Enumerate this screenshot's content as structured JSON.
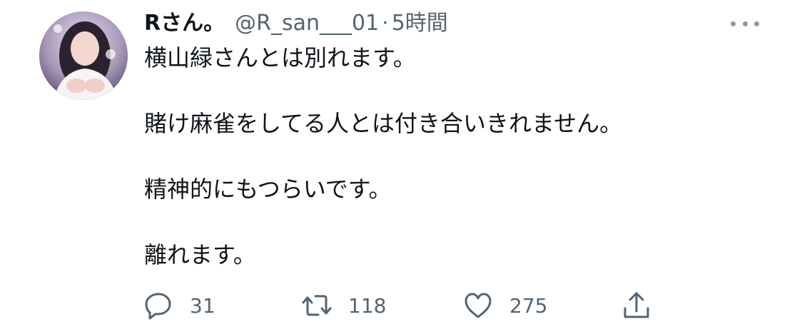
{
  "user": {
    "display_name": "Rさん。",
    "handle": "@R_san___01",
    "separator": "·",
    "time": "5時間"
  },
  "tweet": {
    "lines": [
      "横山緑さんとは別れます。",
      "賭け麻雀をしてる人とは付き合いきれません。",
      "精神的にもつらいです。",
      "離れます。"
    ]
  },
  "actions": {
    "reply": {
      "icon": "reply-icon",
      "count": "31"
    },
    "retweet": {
      "icon": "retweet-icon",
      "count": "118"
    },
    "like": {
      "icon": "heart-icon",
      "count": "275"
    },
    "share": {
      "icon": "share-icon"
    }
  },
  "colors": {
    "text": "#0f1419",
    "secondary": "#536471",
    "icon": "#536471"
  }
}
